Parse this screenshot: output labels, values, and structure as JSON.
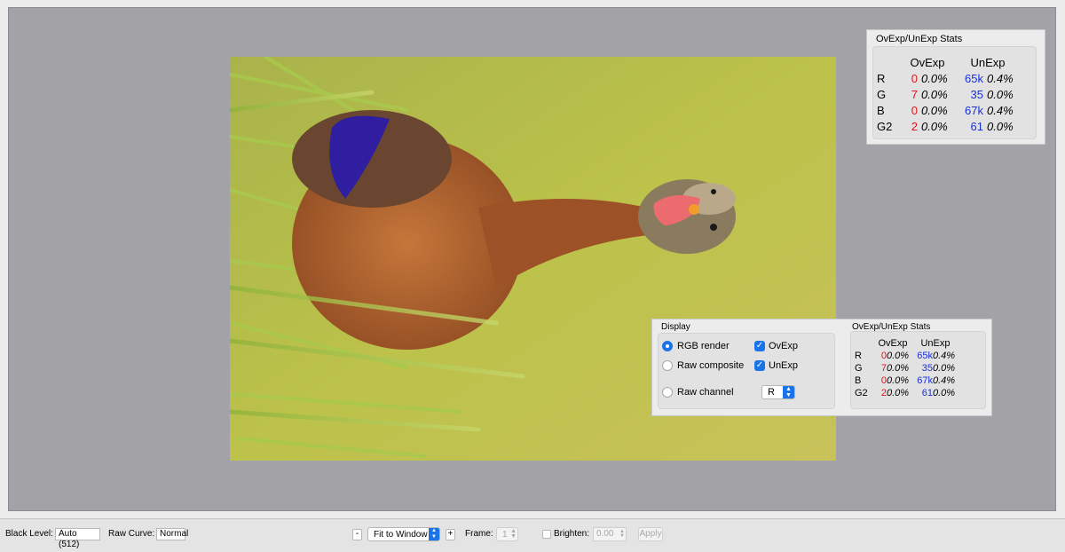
{
  "big_stats": {
    "title": "OvExp/UnExp Stats",
    "header_ov": "OvExp",
    "header_un": "UnExp",
    "rows": [
      {
        "ch": "R",
        "ov": "0",
        "ov_pct": "0.0%",
        "un": "65k",
        "un_pct": "0.4%"
      },
      {
        "ch": "G",
        "ov": "7",
        "ov_pct": "0.0%",
        "un": "35",
        "un_pct": "0.0%"
      },
      {
        "ch": "B",
        "ov": "0",
        "ov_pct": "0.0%",
        "un": "67k",
        "un_pct": "0.4%"
      },
      {
        "ch": "G2",
        "ov": "2",
        "ov_pct": "0.0%",
        "un": "61",
        "un_pct": "0.0%"
      }
    ]
  },
  "display": {
    "title": "Display",
    "rgb_render": "RGB render",
    "raw_composite": "Raw composite",
    "raw_channel": "Raw channel",
    "ovexp": "OvExp",
    "unexp": "UnExp",
    "channel_value": "R"
  },
  "small_stats": {
    "title": "OvExp/UnExp Stats",
    "header_ov": "OvExp",
    "header_un": "UnExp",
    "rows": [
      {
        "ch": "R",
        "ov": "0",
        "ov_pct": "0.0%",
        "un": "65k",
        "un_pct": "0.4%"
      },
      {
        "ch": "G",
        "ov": "7",
        "ov_pct": "0.0%",
        "un": "35",
        "un_pct": "0.0%"
      },
      {
        "ch": "B",
        "ov": "0",
        "ov_pct": "0.0%",
        "un": "67k",
        "un_pct": "0.4%"
      },
      {
        "ch": "G2",
        "ov": "2",
        "ov_pct": "0.0%",
        "un": "61",
        "un_pct": "0.0%"
      }
    ]
  },
  "toolbar": {
    "black_level_label": "Black Level:",
    "black_level_value": "Auto (512)",
    "raw_curve_label": "Raw Curve:",
    "raw_curve_value": "Normal",
    "zoom_out": "-",
    "zoom_mode": "Fit to Window",
    "zoom_in": "+",
    "frame_label": "Frame:",
    "frame_value": "1",
    "brighten_label": "Brighten:",
    "brighten_value": "0.00",
    "apply_label": "Apply"
  },
  "colors": {
    "overexposed": "#e0121b",
    "underexposed": "#1a2fd6",
    "accent": "#1a73e8",
    "viewport_bg": "#a3a2a7"
  }
}
